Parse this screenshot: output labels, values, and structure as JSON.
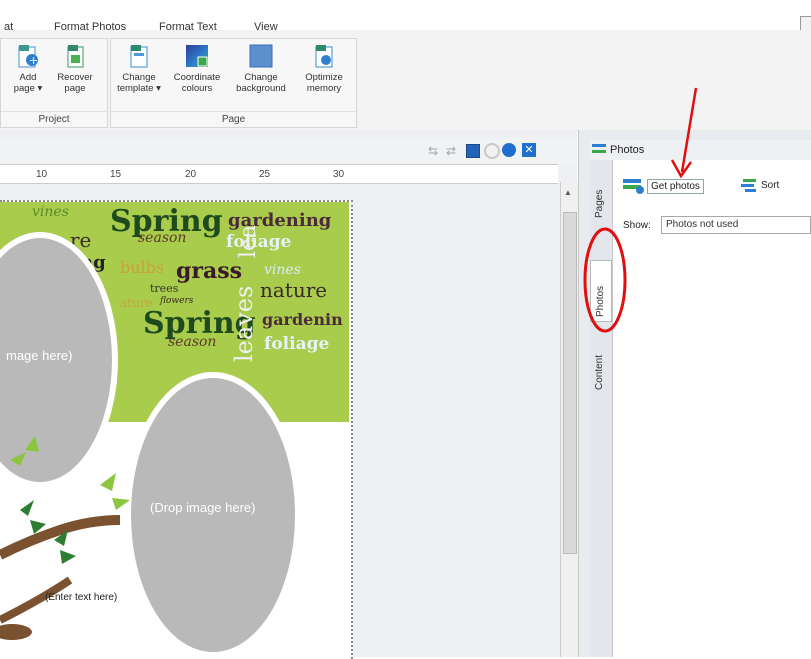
{
  "menu": {
    "items": [
      "at",
      "Format Photos",
      "Format Text",
      "View"
    ]
  },
  "ribbon": {
    "groups": [
      {
        "label": "Project",
        "buttons": [
          {
            "label_line1": "Add",
            "label_line2": "page ▾"
          },
          {
            "label_line1": "Recover",
            "label_line2": "page"
          }
        ]
      },
      {
        "label": "Page",
        "buttons": [
          {
            "label_line1": "Change",
            "label_line2": "template ▾"
          },
          {
            "label_line1": "Coordinate",
            "label_line2": "colours"
          },
          {
            "label_line1": "Change",
            "label_line2": "background"
          },
          {
            "label_line1": "Optimize",
            "label_line2": "memory"
          }
        ]
      }
    ]
  },
  "ruler": {
    "ticks": [
      "10",
      "15",
      "20",
      "25",
      "30"
    ]
  },
  "page": {
    "drop_left": "mage here)",
    "drop_right": "(Drop image here)",
    "enter_text": "(Enter text here)",
    "word_art": {
      "w1": "Spring",
      "w2": "gardening",
      "w3": "season",
      "w4": "foliage",
      "w5": "ng",
      "w6": "bulbs",
      "w7": "grass",
      "w8": "vines",
      "w9": "trees",
      "w10": "nature",
      "w11": "flowers",
      "w12": "Spring",
      "w13": "gardenin",
      "w14": "season",
      "w15": "leaves",
      "w16": "foliage",
      "w17": "re",
      "w18": "ature",
      "w19": "lea",
      "w20": "vines"
    }
  },
  "photos_panel": {
    "title": "Photos",
    "get_photos_label": "Get photos",
    "sort_label": "Sort",
    "show_label": "Show:",
    "show_value": "Photos not used",
    "tabs": [
      "Pages",
      "Photos",
      "Content"
    ]
  },
  "colors": {
    "accent_blue": "#1e5fa8",
    "highlight_red": "#e01010",
    "word_art_green": "#a9cc4c"
  }
}
